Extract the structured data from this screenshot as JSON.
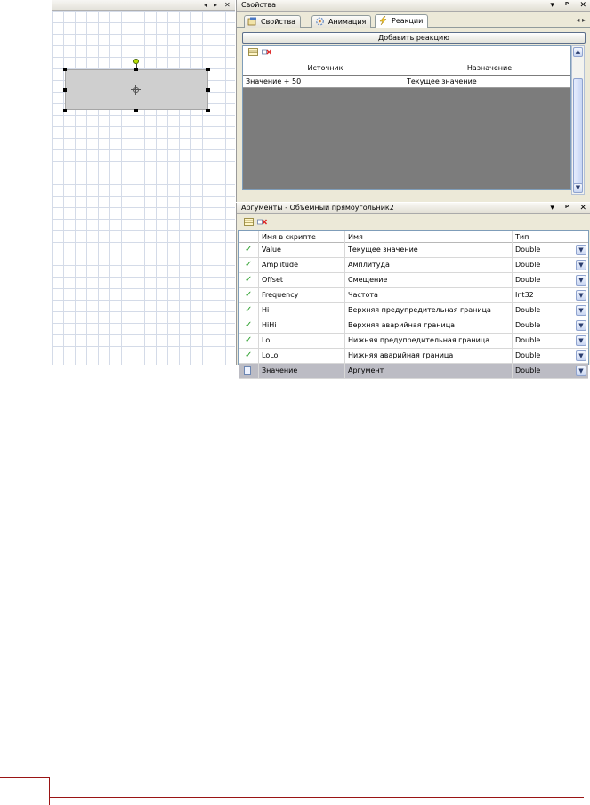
{
  "canvas": {
    "header_buttons": [
      "◂",
      "▸",
      "✕"
    ],
    "shape": {
      "selected": true
    }
  },
  "properties_panel": {
    "title": "Свойства",
    "title_buttons": [
      "▾",
      "ᵖ",
      "✕"
    ],
    "tabs": [
      {
        "label": "Свойства",
        "icon": "properties-icon",
        "active": false
      },
      {
        "label": "Анимация",
        "icon": "animation-icon",
        "active": false
      },
      {
        "label": "Реакции",
        "icon": "lightning-icon",
        "active": true
      }
    ],
    "tab_scroll": "◂ ▸",
    "add_reaction_label": "Добавить реакцию",
    "reactions_table": {
      "columns": [
        "Источник",
        "Назначение"
      ],
      "rows": [
        {
          "source": "Значение + 50",
          "target": "Текущее значение"
        }
      ]
    }
  },
  "arguments_panel": {
    "title": "Аргументы - Объемный прямоугольник2",
    "title_buttons": [
      "▾",
      "ᵖ",
      "✕"
    ],
    "columns": [
      "",
      "Имя в скрипте",
      "Имя",
      "Тип"
    ],
    "rows": [
      {
        "script_name": "Value",
        "name": "Текущее значение",
        "type": "Double",
        "state": "check"
      },
      {
        "script_name": "Amplitude",
        "name": "Амплитуда",
        "type": "Double",
        "state": "check"
      },
      {
        "script_name": "Offset",
        "name": "Смещение",
        "type": "Double",
        "state": "check"
      },
      {
        "script_name": "Frequency",
        "name": "Частота",
        "type": "Int32",
        "state": "check"
      },
      {
        "script_name": "Hi",
        "name": "Верхняя предупредительная граница",
        "type": "Double",
        "state": "check"
      },
      {
        "script_name": "HiHi",
        "name": "Верхняя аварийная граница",
        "type": "Double",
        "state": "check"
      },
      {
        "script_name": "Lo",
        "name": "Нижняя предупредительная граница",
        "type": "Double",
        "state": "check"
      },
      {
        "script_name": "LoLo",
        "name": "Нижняя аварийная граница",
        "type": "Double",
        "state": "check"
      },
      {
        "script_name": "Значение",
        "name": "Аргумент",
        "type": "Double",
        "state": "new",
        "selected": true
      }
    ]
  },
  "colors": {
    "panel_bg": "#ece9d8",
    "check_green": "#2ca02c",
    "footer_line": "#9a1414",
    "selected_row": "#bcbcc4"
  }
}
